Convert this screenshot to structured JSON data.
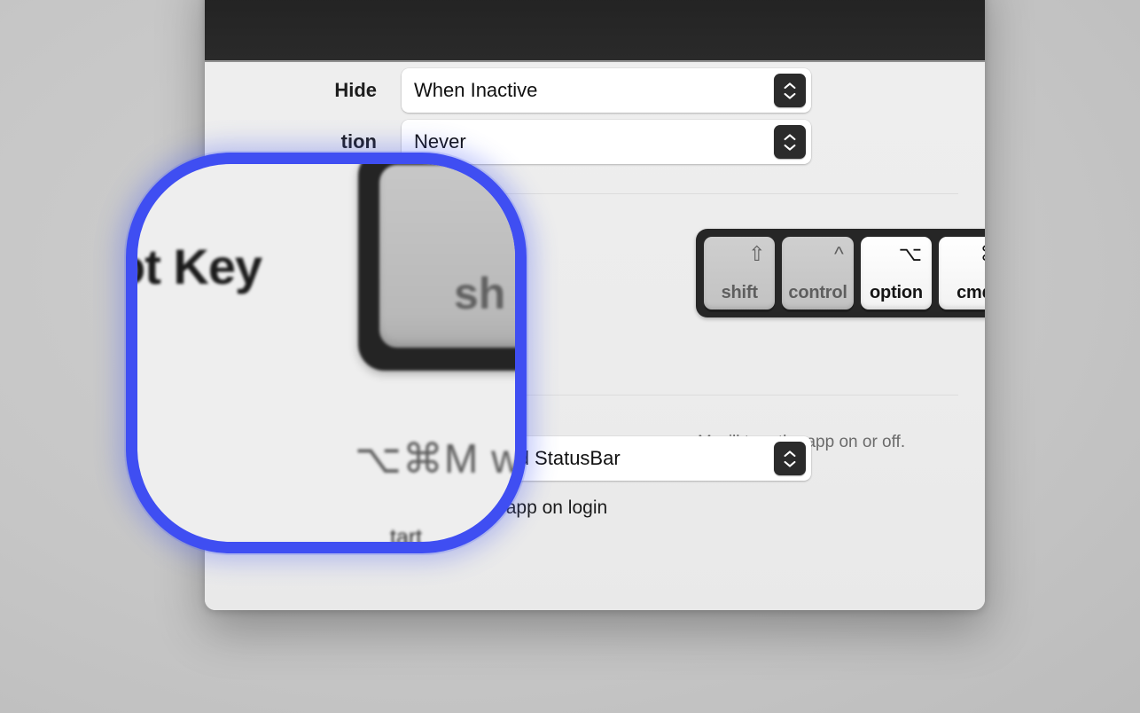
{
  "window": {
    "title": "",
    "background_color": "#ececec",
    "titlebar_color": "#222222"
  },
  "desktop": {
    "background_color": "#c6c6c6"
  },
  "settings": {
    "rows": [
      {
        "label": "Hide",
        "value": "When Inactive",
        "control": "popup-button"
      },
      {
        "label": "tion",
        "value": "Never",
        "control": "popup-button"
      }
    ],
    "appearance_row": {
      "label": "",
      "value": "Dock and StatusBar",
      "icon": "dock-icon",
      "control": "popup-button"
    },
    "startup_row": {
      "label": "tart",
      "checkbox_label": "Launch app on login",
      "checked": false
    }
  },
  "hotkey": {
    "label_partial": "ot Key",
    "label_full": "Hot Key",
    "hint": "M will turn the app on or off.",
    "shortcut_display": "⌥⌘M w",
    "keys": [
      {
        "name": "shift",
        "glyph": "⇧",
        "label": "shift",
        "selected": false
      },
      {
        "name": "control",
        "glyph": "^",
        "label": "control",
        "selected": false
      },
      {
        "name": "option",
        "glyph": "⌥",
        "label": "option",
        "selected": true
      },
      {
        "name": "cmd",
        "glyph": "⌘",
        "label": "cmd",
        "selected": true
      }
    ],
    "letter_key": {
      "value": "M",
      "control": "stepper"
    },
    "track_color": "#262626"
  },
  "loupe": {
    "ring_color": "#3f4ef2",
    "magnified_label": "ot Key",
    "magnified_key_label": "sh",
    "magnified_shortcut": "⌥⌘M w",
    "magnified_start": "tart"
  },
  "icons": {
    "stepper_up": "chevron-up-icon",
    "stepper_down": "chevron-down-icon",
    "dock": "dock-icon"
  }
}
